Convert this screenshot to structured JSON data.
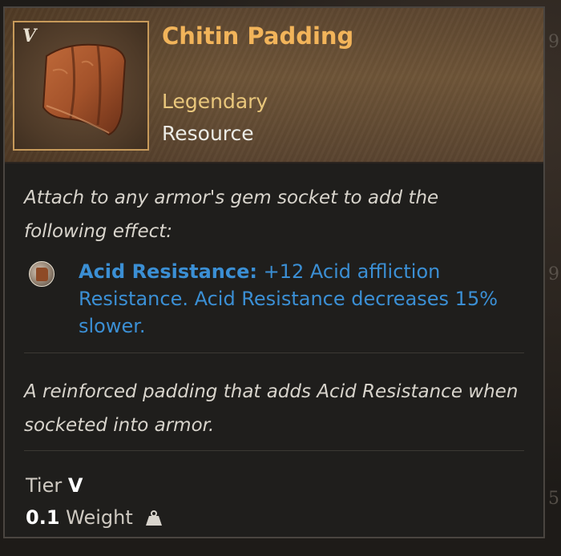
{
  "item": {
    "tier_mark": "V",
    "name": "Chitin Padding",
    "rarity": "Legendary",
    "type": "Resource"
  },
  "description": "Attach to any armor's gem socket to add the following effect:",
  "perk": {
    "icon": "padding-gem-icon",
    "name": "Acid Resistance:",
    "text": "+12 Acid affliction Resistance. Acid Resistance decreases 15% slower."
  },
  "flavor": "A reinforced padding that adds Acid Resistance when socketed into armor.",
  "stats": {
    "tier_label": "Tier",
    "tier_value": "V",
    "weight_value": "0.1",
    "weight_label": "Weight"
  },
  "colors": {
    "name": "#f2b45a",
    "rarity": "#e9c77c",
    "perk": "#3b8fd4"
  }
}
